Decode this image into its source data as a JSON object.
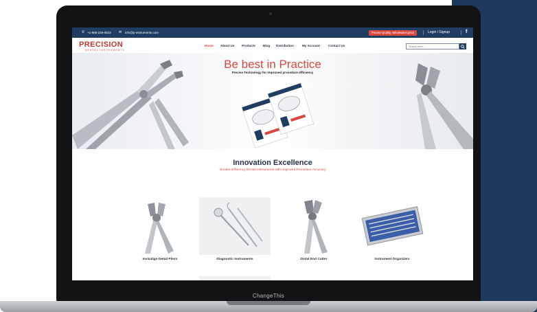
{
  "device": {
    "brand_label": "ChangeThis"
  },
  "topbar": {
    "phone": "+1-888-228-0533",
    "email": "info@p-instruments.com",
    "cta": "Precise Quality, Wholesales price",
    "login": "Login / Signup",
    "facebook": "f"
  },
  "logo": {
    "main": "PRECISION",
    "sub": "DENTAL INSTRUMENTS"
  },
  "nav": {
    "items": [
      {
        "label": "Home",
        "active": true
      },
      {
        "label": "About Us"
      },
      {
        "label": "Products"
      },
      {
        "label": "Blog"
      },
      {
        "label": "Distribution"
      },
      {
        "label": "My Account"
      },
      {
        "label": "Contact Us"
      }
    ],
    "search_placeholder": "Search here..."
  },
  "hero": {
    "title": "Be best in Practice",
    "subtitle": "Precise Technology for Improved procedure efficiency"
  },
  "section": {
    "title": "Innovation Excellence",
    "subtitle": "Greater Efficiency Dental Instruments with Improved Procedure Accuracy"
  },
  "products": [
    {
      "label": "Invisalign Detail Pliers"
    },
    {
      "label": "Diagnostic Instruments"
    },
    {
      "label": "Distal End Cutter"
    },
    {
      "label": "Instrument Organizers"
    }
  ],
  "colors": {
    "accent": "#d9473f",
    "navy": "#1f3c63",
    "background_block": "#1d3a5c"
  },
  "icons": {
    "phone": "phone-icon",
    "email": "mail-icon",
    "search": "search-icon",
    "facebook": "facebook-icon"
  }
}
